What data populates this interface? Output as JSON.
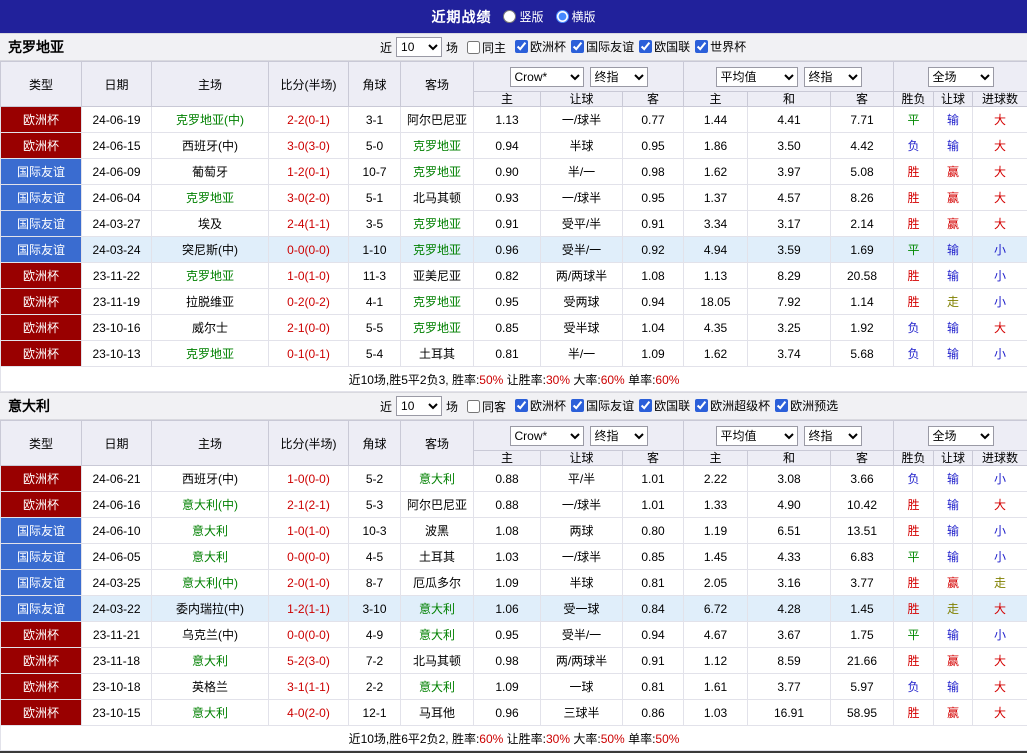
{
  "top_bar": {
    "title": "近期战绩",
    "vertical_label": "竖版",
    "horizontal_label": "横版",
    "selected": "横版"
  },
  "table_header": {
    "col_type": "类型",
    "col_date": "日期",
    "col_home": "主场",
    "col_score": "比分(半场)",
    "col_corner": "角球",
    "col_away": "客场",
    "dd_bookmaker": "Crow*",
    "dd_stage1": "终指",
    "dd_average": "平均值",
    "dd_stage2": "终指",
    "dd_scope": "全场",
    "sub_home1": "主",
    "sub_handicap1": "让球",
    "sub_away1": "客",
    "sub_home2": "主",
    "sub_draw": "和",
    "sub_away2": "客",
    "sub_result": "胜负",
    "sub_handicap2": "让球",
    "sub_goals": "进球数"
  },
  "palette": {
    "topbar_bg": "#21219b",
    "team_green": "#008000",
    "score_red": "#cc0000",
    "win_red": "#d40000",
    "lose_blue": "#2222cc",
    "draw_green": "#008800",
    "push_olive": "#808000",
    "row_highlight": "#e0eefa",
    "type_colors": {
      "欧洲杯": "#990000",
      "国际友谊": "#3a6cd0"
    },
    "result_colors": {
      "胜": "win_red",
      "负": "lose_blue",
      "平": "draw_green",
      "输": "lose_blue",
      "赢": "win_red",
      "走": "push_olive",
      "大": "win_red",
      "小": "lose_blue"
    }
  },
  "sections": [
    {
      "team": "克罗地亚",
      "filter": {
        "near_label": "近",
        "near_value": "10",
        "games_label": "场",
        "same_label": "同主",
        "same_checked": false,
        "competitions": [
          {
            "label": "欧洲杯",
            "checked": true
          },
          {
            "label": "国际友谊",
            "checked": true
          },
          {
            "label": "欧国联",
            "checked": true
          },
          {
            "label": "世界杯",
            "checked": true
          }
        ]
      },
      "rows": [
        {
          "type": "欧洲杯",
          "date": "24-06-19",
          "home": "克罗地亚(中)",
          "home_is_team": true,
          "score": "2-2(0-1)",
          "corner": "3-1",
          "away": "阿尔巴尼亚",
          "away_is_team": false,
          "crow_home": "1.13",
          "handicap": "一/球半",
          "crow_away": "0.77",
          "avg_home": "1.44",
          "avg_draw": "4.41",
          "avg_away": "7.71",
          "result_wdl": "平",
          "result_handicap": "输",
          "result_goals": "大",
          "highlight": false
        },
        {
          "type": "欧洲杯",
          "date": "24-06-15",
          "home": "西班牙(中)",
          "home_is_team": false,
          "score": "3-0(3-0)",
          "corner": "5-0",
          "away": "克罗地亚",
          "away_is_team": true,
          "crow_home": "0.94",
          "handicap": "半球",
          "crow_away": "0.95",
          "avg_home": "1.86",
          "avg_draw": "3.50",
          "avg_away": "4.42",
          "result_wdl": "负",
          "result_handicap": "输",
          "result_goals": "大",
          "highlight": false
        },
        {
          "type": "国际友谊",
          "date": "24-06-09",
          "home": "葡萄牙",
          "home_is_team": false,
          "score": "1-2(0-1)",
          "corner": "10-7",
          "away": "克罗地亚",
          "away_is_team": true,
          "crow_home": "0.90",
          "handicap": "半/一",
          "crow_away": "0.98",
          "avg_home": "1.62",
          "avg_draw": "3.97",
          "avg_away": "5.08",
          "result_wdl": "胜",
          "result_handicap": "赢",
          "result_goals": "大",
          "highlight": false
        },
        {
          "type": "国际友谊",
          "date": "24-06-04",
          "home": "克罗地亚",
          "home_is_team": true,
          "score": "3-0(2-0)",
          "corner": "5-1",
          "away": "北马其顿",
          "away_is_team": false,
          "crow_home": "0.93",
          "handicap": "一/球半",
          "crow_away": "0.95",
          "avg_home": "1.37",
          "avg_draw": "4.57",
          "avg_away": "8.26",
          "result_wdl": "胜",
          "result_handicap": "赢",
          "result_goals": "大",
          "highlight": false
        },
        {
          "type": "国际友谊",
          "date": "24-03-27",
          "home": "埃及",
          "home_is_team": false,
          "score": "2-4(1-1)",
          "corner": "3-5",
          "away": "克罗地亚",
          "away_is_team": true,
          "crow_home": "0.91",
          "handicap": "受平/半",
          "crow_away": "0.91",
          "avg_home": "3.34",
          "avg_draw": "3.17",
          "avg_away": "2.14",
          "result_wdl": "胜",
          "result_handicap": "赢",
          "result_goals": "大",
          "highlight": false
        },
        {
          "type": "国际友谊",
          "date": "24-03-24",
          "home": "突尼斯(中)",
          "home_is_team": false,
          "score": "0-0(0-0)",
          "corner": "1-10",
          "away": "克罗地亚",
          "away_is_team": true,
          "crow_home": "0.96",
          "handicap": "受半/一",
          "crow_away": "0.92",
          "avg_home": "4.94",
          "avg_draw": "3.59",
          "avg_away": "1.69",
          "result_wdl": "平",
          "result_handicap": "输",
          "result_goals": "小",
          "highlight": true
        },
        {
          "type": "欧洲杯",
          "date": "23-11-22",
          "home": "克罗地亚",
          "home_is_team": true,
          "score": "1-0(1-0)",
          "corner": "11-3",
          "away": "亚美尼亚",
          "away_is_team": false,
          "crow_home": "0.82",
          "handicap": "两/两球半",
          "crow_away": "1.08",
          "avg_home": "1.13",
          "avg_draw": "8.29",
          "avg_away": "20.58",
          "result_wdl": "胜",
          "result_handicap": "输",
          "result_goals": "小",
          "highlight": false
        },
        {
          "type": "欧洲杯",
          "date": "23-11-19",
          "home": "拉脱维亚",
          "home_is_team": false,
          "score": "0-2(0-2)",
          "corner": "4-1",
          "away": "克罗地亚",
          "away_is_team": true,
          "crow_home": "0.95",
          "handicap": "受两球",
          "crow_away": "0.94",
          "avg_home": "18.05",
          "avg_draw": "7.92",
          "avg_away": "1.14",
          "result_wdl": "胜",
          "result_handicap": "走",
          "result_goals": "小",
          "highlight": false
        },
        {
          "type": "欧洲杯",
          "date": "23-10-16",
          "home": "威尔士",
          "home_is_team": false,
          "score": "2-1(0-0)",
          "corner": "5-5",
          "away": "克罗地亚",
          "away_is_team": true,
          "crow_home": "0.85",
          "handicap": "受半球",
          "crow_away": "1.04",
          "avg_home": "4.35",
          "avg_draw": "3.25",
          "avg_away": "1.92",
          "result_wdl": "负",
          "result_handicap": "输",
          "result_goals": "大",
          "highlight": false
        },
        {
          "type": "欧洲杯",
          "date": "23-10-13",
          "home": "克罗地亚",
          "home_is_team": true,
          "score": "0-1(0-1)",
          "corner": "5-4",
          "away": "土耳其",
          "away_is_team": false,
          "crow_home": "0.81",
          "handicap": "半/一",
          "crow_away": "1.09",
          "avg_home": "1.62",
          "avg_draw": "3.74",
          "avg_away": "5.68",
          "result_wdl": "负",
          "result_handicap": "输",
          "result_goals": "小",
          "highlight": false
        }
      ],
      "summary": {
        "prefix": "近10场,胜5平2负3,",
        "stats": [
          {
            "label": "胜率:",
            "value": "50%"
          },
          {
            "label": "让胜率:",
            "value": "30%"
          },
          {
            "label": "大率:",
            "value": "60%"
          },
          {
            "label": "单率:",
            "value": "60%"
          }
        ]
      }
    },
    {
      "team": "意大利",
      "filter": {
        "near_label": "近",
        "near_value": "10",
        "games_label": "场",
        "same_label": "同客",
        "same_checked": false,
        "competitions": [
          {
            "label": "欧洲杯",
            "checked": true
          },
          {
            "label": "国际友谊",
            "checked": true
          },
          {
            "label": "欧国联",
            "checked": true
          },
          {
            "label": "欧洲超级杯",
            "checked": true
          },
          {
            "label": "欧洲预选",
            "checked": true
          }
        ]
      },
      "rows": [
        {
          "type": "欧洲杯",
          "date": "24-06-21",
          "home": "西班牙(中)",
          "home_is_team": false,
          "score": "1-0(0-0)",
          "corner": "5-2",
          "away": "意大利",
          "away_is_team": true,
          "crow_home": "0.88",
          "handicap": "平/半",
          "crow_away": "1.01",
          "avg_home": "2.22",
          "avg_draw": "3.08",
          "avg_away": "3.66",
          "result_wdl": "负",
          "result_handicap": "输",
          "result_goals": "小",
          "highlight": false
        },
        {
          "type": "欧洲杯",
          "date": "24-06-16",
          "home": "意大利(中)",
          "home_is_team": true,
          "score": "2-1(2-1)",
          "corner": "5-3",
          "away": "阿尔巴尼亚",
          "away_is_team": false,
          "crow_home": "0.88",
          "handicap": "一/球半",
          "crow_away": "1.01",
          "avg_home": "1.33",
          "avg_draw": "4.90",
          "avg_away": "10.42",
          "result_wdl": "胜",
          "result_handicap": "输",
          "result_goals": "大",
          "highlight": false
        },
        {
          "type": "国际友谊",
          "date": "24-06-10",
          "home": "意大利",
          "home_is_team": true,
          "score": "1-0(1-0)",
          "corner": "10-3",
          "away": "波黑",
          "away_is_team": false,
          "crow_home": "1.08",
          "handicap": "两球",
          "crow_away": "0.80",
          "avg_home": "1.19",
          "avg_draw": "6.51",
          "avg_away": "13.51",
          "result_wdl": "胜",
          "result_handicap": "输",
          "result_goals": "小",
          "highlight": false
        },
        {
          "type": "国际友谊",
          "date": "24-06-05",
          "home": "意大利",
          "home_is_team": true,
          "score": "0-0(0-0)",
          "corner": "4-5",
          "away": "土耳其",
          "away_is_team": false,
          "crow_home": "1.03",
          "handicap": "一/球半",
          "crow_away": "0.85",
          "avg_home": "1.45",
          "avg_draw": "4.33",
          "avg_away": "6.83",
          "result_wdl": "平",
          "result_handicap": "输",
          "result_goals": "小",
          "highlight": false
        },
        {
          "type": "国际友谊",
          "date": "24-03-25",
          "home": "意大利(中)",
          "home_is_team": true,
          "score": "2-0(1-0)",
          "corner": "8-7",
          "away": "厄瓜多尔",
          "away_is_team": false,
          "crow_home": "1.09",
          "handicap": "半球",
          "crow_away": "0.81",
          "avg_home": "2.05",
          "avg_draw": "3.16",
          "avg_away": "3.77",
          "result_wdl": "胜",
          "result_handicap": "赢",
          "result_goals": "走",
          "highlight": false
        },
        {
          "type": "国际友谊",
          "date": "24-03-22",
          "home": "委内瑞拉(中)",
          "home_is_team": false,
          "score": "1-2(1-1)",
          "corner": "3-10",
          "away": "意大利",
          "away_is_team": true,
          "crow_home": "1.06",
          "handicap": "受一球",
          "crow_away": "0.84",
          "avg_home": "6.72",
          "avg_draw": "4.28",
          "avg_away": "1.45",
          "result_wdl": "胜",
          "result_handicap": "走",
          "result_goals": "大",
          "highlight": true
        },
        {
          "type": "欧洲杯",
          "date": "23-11-21",
          "home": "乌克兰(中)",
          "home_is_team": false,
          "score": "0-0(0-0)",
          "corner": "4-9",
          "away": "意大利",
          "away_is_team": true,
          "crow_home": "0.95",
          "handicap": "受半/一",
          "crow_away": "0.94",
          "avg_home": "4.67",
          "avg_draw": "3.67",
          "avg_away": "1.75",
          "result_wdl": "平",
          "result_handicap": "输",
          "result_goals": "小",
          "highlight": false
        },
        {
          "type": "欧洲杯",
          "date": "23-11-18",
          "home": "意大利",
          "home_is_team": true,
          "score": "5-2(3-0)",
          "corner": "7-2",
          "away": "北马其顿",
          "away_is_team": false,
          "crow_home": "0.98",
          "handicap": "两/两球半",
          "crow_away": "0.91",
          "avg_home": "1.12",
          "avg_draw": "8.59",
          "avg_away": "21.66",
          "result_wdl": "胜",
          "result_handicap": "赢",
          "result_goals": "大",
          "highlight": false
        },
        {
          "type": "欧洲杯",
          "date": "23-10-18",
          "home": "英格兰",
          "home_is_team": false,
          "score": "3-1(1-1)",
          "corner": "2-2",
          "away": "意大利",
          "away_is_team": true,
          "crow_home": "1.09",
          "handicap": "一球",
          "crow_away": "0.81",
          "avg_home": "1.61",
          "avg_draw": "3.77",
          "avg_away": "5.97",
          "result_wdl": "负",
          "result_handicap": "输",
          "result_goals": "大",
          "highlight": false
        },
        {
          "type": "欧洲杯",
          "date": "23-10-15",
          "home": "意大利",
          "home_is_team": true,
          "score": "4-0(2-0)",
          "corner": "12-1",
          "away": "马耳他",
          "away_is_team": false,
          "crow_home": "0.96",
          "handicap": "三球半",
          "crow_away": "0.86",
          "avg_home": "1.03",
          "avg_draw": "16.91",
          "avg_away": "58.95",
          "result_wdl": "胜",
          "result_handicap": "赢",
          "result_goals": "大",
          "highlight": false
        }
      ],
      "summary": {
        "prefix": "近10场,胜6平2负2,",
        "stats": [
          {
            "label": "胜率:",
            "value": "60%"
          },
          {
            "label": "让胜率:",
            "value": "30%"
          },
          {
            "label": "大率:",
            "value": "50%"
          },
          {
            "label": "单率:",
            "value": "50%"
          }
        ]
      }
    }
  ]
}
